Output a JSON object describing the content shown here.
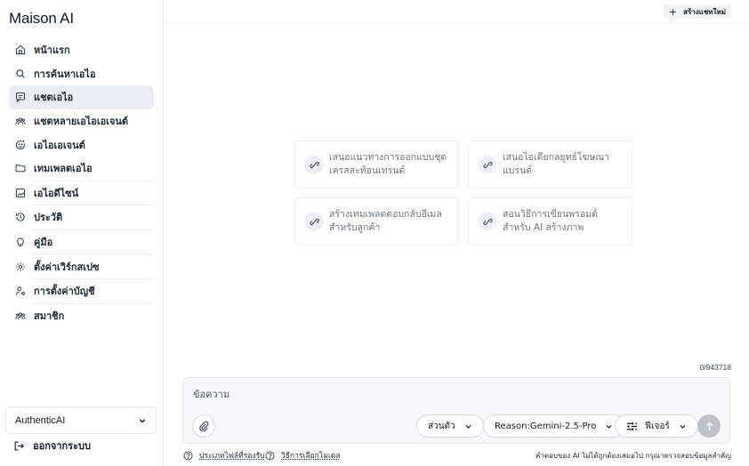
{
  "app": {
    "name": "Maison AI"
  },
  "sidebar": {
    "items": [
      {
        "label": "หน้าแรก",
        "icon": "home-icon",
        "active": false
      },
      {
        "label": "การค้นหาเอไอ",
        "icon": "search-icon",
        "active": false
      },
      {
        "label": "แชตเอไอ",
        "icon": "chat-icon",
        "active": true
      },
      {
        "label": "แชตหลายเอไอเอเจนต์",
        "icon": "users-icon",
        "active": false
      },
      {
        "label": "เอไอเอเจนต์",
        "icon": "bot-face-icon",
        "active": false
      },
      {
        "label": "เทมเพลตเอไอ",
        "icon": "folder-icon",
        "active": false
      },
      {
        "label": "เอไอดีไซน์",
        "icon": "image-icon",
        "active": false
      },
      {
        "label": "ประวัติ",
        "icon": "history-icon",
        "active": false
      },
      {
        "label": "คู่มือ",
        "icon": "lightbulb-icon",
        "active": false
      },
      {
        "label": "ตั้งค่าเวิร์กสเปซ",
        "icon": "gear-icon",
        "active": false
      },
      {
        "label": "การตั้งค่าบัญชี",
        "icon": "user-settings-icon",
        "active": false
      },
      {
        "label": "สมาชิก",
        "icon": "members-icon",
        "active": false
      }
    ],
    "workspace": "AuthenticAI",
    "logout": "ออกจากระบบ"
  },
  "header": {
    "new_chat": "สร้างแชทใหม่"
  },
  "suggestions": [
    {
      "text": "เสนอแนวทางการออกแบบชุดเครสสะท้อนเทรนด์"
    },
    {
      "text": "เสนอไอเดียกลยุทธ์โฆษณาแบรนด์"
    },
    {
      "text": "สร้างเทมเพลตตอบกลับอีเมลสำหรับลูกค้า"
    },
    {
      "text": "สอนวิธีการเขียนพรอมต์สำหรับ AI สร้างภาพ"
    }
  ],
  "composer": {
    "counter": "0/943718",
    "placeholder": "ข้อความ",
    "value": "",
    "mode": "ส่วนตัว",
    "model": "Reason:Gemini-2.5-Pro",
    "features": "ฟีเจอร์"
  },
  "footer": {
    "supported_files": "ประเภทไฟล์ที่รองรับ",
    "model_guide": "วิธีการเลือกโมเดล",
    "disclaimer": "คำตอบของ AI ไม่ได้ถูกต้องเสมอไป กรุณาตรวจสอบข้อมูลสำคัญ"
  },
  "colors": {
    "active_bg": "#ececf6",
    "composer_bg": "#f7f7fa",
    "send_disabled": "#bfc2cc"
  }
}
